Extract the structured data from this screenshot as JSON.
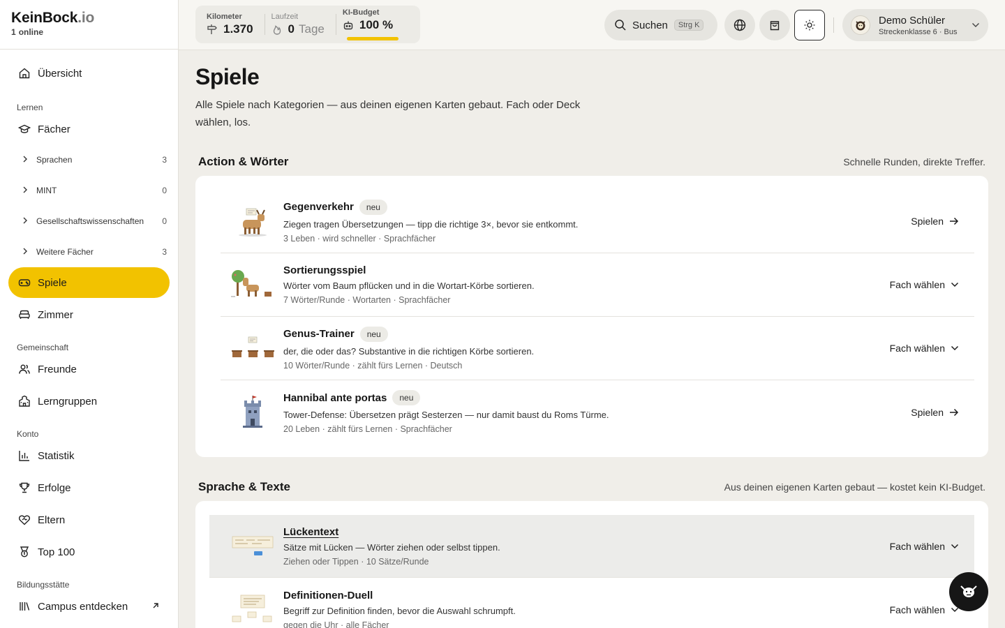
{
  "brand": {
    "name": "KeinBock",
    "tld": ".io",
    "online_count": "1",
    "online_label": "online"
  },
  "sidebar": {
    "overview": "Übersicht",
    "sections": {
      "learn": "Lernen",
      "community": "Gemeinschaft",
      "account": "Konto",
      "campus": "Bildungsstätte"
    },
    "subjects": "Fächer",
    "subject_groups": [
      {
        "label": "Sprachen",
        "count": "3"
      },
      {
        "label": "MINT",
        "count": "0"
      },
      {
        "label": "Gesellschaftswissenschaften",
        "count": "0"
      },
      {
        "label": "Weitere Fächer",
        "count": "3"
      }
    ],
    "games": "Spiele",
    "room": "Zimmer",
    "friends": "Freunde",
    "groups": "Lerngruppen",
    "stats": "Statistik",
    "achievements": "Erfolge",
    "parents": "Eltern",
    "top100": "Top 100",
    "discover": "Campus entdecken"
  },
  "topbar": {
    "km_label": "Kilometer",
    "km_value": "1.370",
    "streak_label": "Laufzeit",
    "streak_value": "0",
    "streak_unit": "Tage",
    "budget_label": "KI-Budget",
    "budget_value": "100 %",
    "budget_fraction": 1.0,
    "search_label": "Suchen",
    "search_shortcut": "Strg K",
    "user_name": "Demo Schüler",
    "user_sub": "Streckenklasse 6 · Bus"
  },
  "page": {
    "title": "Spiele",
    "description": "Alle Spiele nach Kategorien — aus deinen eigenen Karten gebaut. Fach oder Deck wählen, los."
  },
  "sections": [
    {
      "title": "Action & Wörter",
      "note": "Schnelle Runden, direkte Treffer.",
      "games": [
        {
          "name": "Gegenverkehr",
          "badge": "neu",
          "desc": "Ziegen tragen Übersetzungen — tipp die richtige 3×, bevor sie entkommt.",
          "meta": "3 Leben · wird schneller · Sprachfächer",
          "action": "Spielen"
        },
        {
          "name": "Sortierungsspiel",
          "badge": "",
          "desc": "Wörter vom Baum pflücken und in die Wortart-Körbe sortieren.",
          "meta": "7 Wörter/Runde · Wortarten · Sprachfächer",
          "action": "Fach wählen"
        },
        {
          "name": "Genus-Trainer",
          "badge": "neu",
          "desc": "der, die oder das? Substantive in die richtigen Körbe sortieren.",
          "meta": "10 Wörter/Runde · zählt fürs Lernen · Deutsch",
          "action": "Fach wählen"
        },
        {
          "name": "Hannibal ante portas",
          "badge": "neu",
          "desc": "Tower-Defense: Übersetzen prägt Sesterzen — nur damit baust du Roms Türme.",
          "meta": "20 Leben · zählt fürs Lernen · Sprachfächer",
          "action": "Spielen"
        }
      ]
    },
    {
      "title": "Sprache & Texte",
      "note": "Aus deinen eigenen Karten gebaut — kostet kein KI-Budget.",
      "games": [
        {
          "name": "Lückentext",
          "badge": "",
          "desc": "Sätze mit Lücken — Wörter ziehen oder selbst tippen.",
          "meta": "Ziehen oder Tippen · 10 Sätze/Runde",
          "action": "Fach wählen"
        },
        {
          "name": "Definitionen-Duell",
          "badge": "",
          "desc": "Begriff zur Definition finden, bevor die Auswahl schrumpft.",
          "meta": "gegen die Uhr · alle Fächer",
          "action": "Fach wählen"
        }
      ]
    }
  ],
  "colors": {
    "accent": "#f2c200",
    "background": "#f0eee9",
    "card": "#ffffff"
  }
}
